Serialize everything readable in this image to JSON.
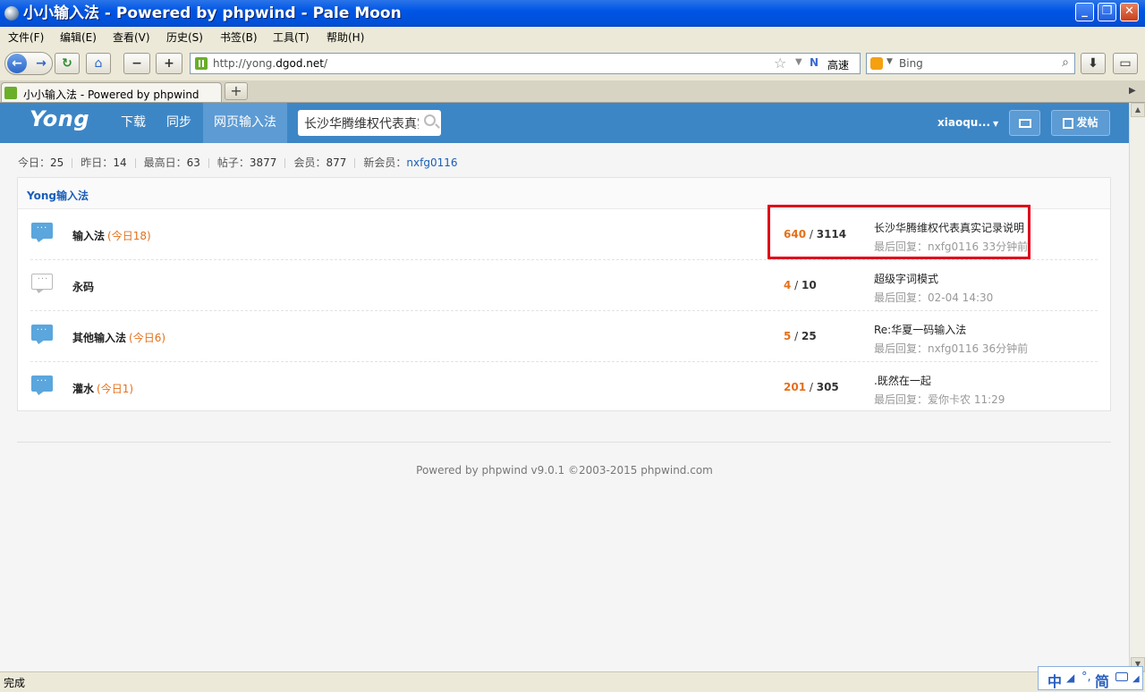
{
  "window": {
    "title": "小小输入法 - Powered by phpwind - Pale Moon",
    "minimize": "_",
    "maximize": "❐",
    "close": "✕"
  },
  "menu": [
    "文件(F)",
    "编辑(E)",
    "查看(V)",
    "历史(S)",
    "书签(B)",
    "工具(T)",
    "帮助(H)"
  ],
  "toolbar": {
    "url_prefix": "http://yong.",
    "url_domain": "dgod.net",
    "url_suffix": "/",
    "speed_label": "高速",
    "search_engine": "Bing",
    "zoom_out": "−",
    "zoom_in": "+"
  },
  "tabs": [
    {
      "label": "小小输入法 - Powered by phpwind"
    }
  ],
  "site": {
    "logo": "Yong",
    "nav": [
      "下载",
      "同步",
      "网页输入法"
    ],
    "search_value": "长沙华腾维权代表真实记录说明",
    "user": "xiaoqu...",
    "post_button": "发帖"
  },
  "stats": {
    "today_label": "今日：",
    "today": "25",
    "yesterday_label": "昨日：",
    "yesterday": "14",
    "max_label": "最高日：",
    "max": "63",
    "posts_label": "帖子：",
    "posts": "3877",
    "members_label": "会员：",
    "members": "877",
    "newmember_label": "新会员：",
    "newmember": "nxfg0116"
  },
  "category": {
    "title": "Yong输入法",
    "forums": [
      {
        "name": "输入法",
        "today": "(今日18)",
        "topics": "640",
        "posts": "3114",
        "last_title": "长沙华腾维权代表真实记录说明",
        "last_meta": "最后回复：nxfg0116 33分钟前",
        "active": true
      },
      {
        "name": "永码",
        "today": "",
        "topics": "4",
        "posts": "10",
        "last_title": "超级字词模式",
        "last_meta": "最后回复：02-04 14:30",
        "active": false
      },
      {
        "name": "其他输入法",
        "today": "(今日6)",
        "topics": "5",
        "posts": "25",
        "last_title": "Re:华夏一码输入法",
        "last_meta": "最后回复：nxfg0116 36分钟前",
        "active": true
      },
      {
        "name": "灌水",
        "today": "(今日1)",
        "topics": "201",
        "posts": "305",
        "last_title": ".既然在一起",
        "last_meta": "最后回复：爱你卡农 11:29",
        "active": true
      }
    ]
  },
  "footer": "Powered by phpwind v9.0.1 ©2003-2015 phpwind.com",
  "statusbar": {
    "status": "完成",
    "ime_zh": "中",
    "ime_jian": "简"
  }
}
